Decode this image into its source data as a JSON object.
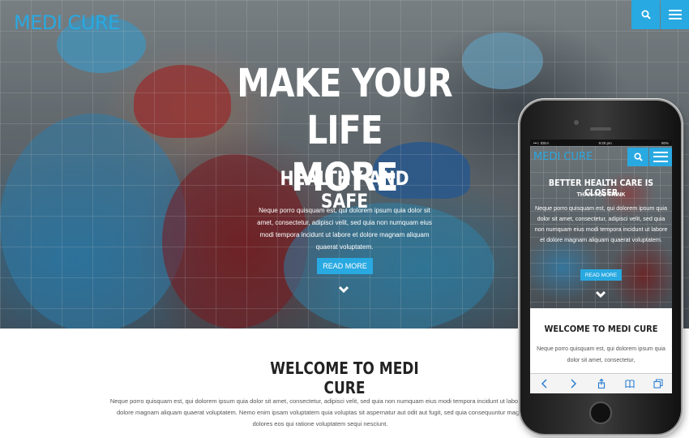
{
  "brand": {
    "logo": "MEDI CURE",
    "accent_color": "#29a9e1"
  },
  "header": {
    "search_icon": "search-icon",
    "menu_icon": "hamburger-menu-icon"
  },
  "hero": {
    "title_line1": "MAKE YOUR LIFE",
    "title_line2": "MORE",
    "subtitle": "HEALTHY AND SAFE",
    "text": "Neque porro quisquam est, qui dolorem ipsum quia dolor sit amet, consectetur, adipisci velit, sed quia non numquam eius modi tempora incidunt ut labore et dolore magnam aliquam quaerat voluptatem.",
    "button": "READ MORE",
    "scroll_icon": "chevron-down-icon"
  },
  "welcome": {
    "title": "WELCOME TO MEDI CURE",
    "text": "Neque porro quisquam est, qui dolorem ipsum quia dolor sit amet, consectetur, adipisci velit, sed quia non numquam eius modi tempora incidunt ut labore et dolore magnam aliquam quaerat voluptatem. Nemo enim ipsam voluptatem quia voluptas sit aspernatur aut odit aut fugit, sed quia consequuntur magni dolores eos qui ratione voluptatem sequi nesciunt."
  },
  "phone": {
    "status_carrier": "•••○ IDEA",
    "status_time": "9:20 pm",
    "status_battery": "90%",
    "logo": "MEDI CURE",
    "title": "BETTER HEALTH CARE IS CLOSER",
    "subtitle": "THAN YOU THINK",
    "text": "Neque porro quisquam est, qui dolorem ipsum quia dolor sit amet, consectetur, adipisci velit, sed quia non numquam eius modi tempora incidunt ut labore et dolore magnam aliquam quaerat voluptatem.",
    "button": "READ MORE",
    "welcome_title": "WELCOME TO MEDI CURE",
    "welcome_text": "Neque porro quisquam est, qui dolorem ipsum quia dolor sit amet, consectetur,",
    "toolbar_icons": [
      "back-icon",
      "forward-icon",
      "share-icon",
      "bookmarks-icon",
      "tabs-icon"
    ]
  }
}
